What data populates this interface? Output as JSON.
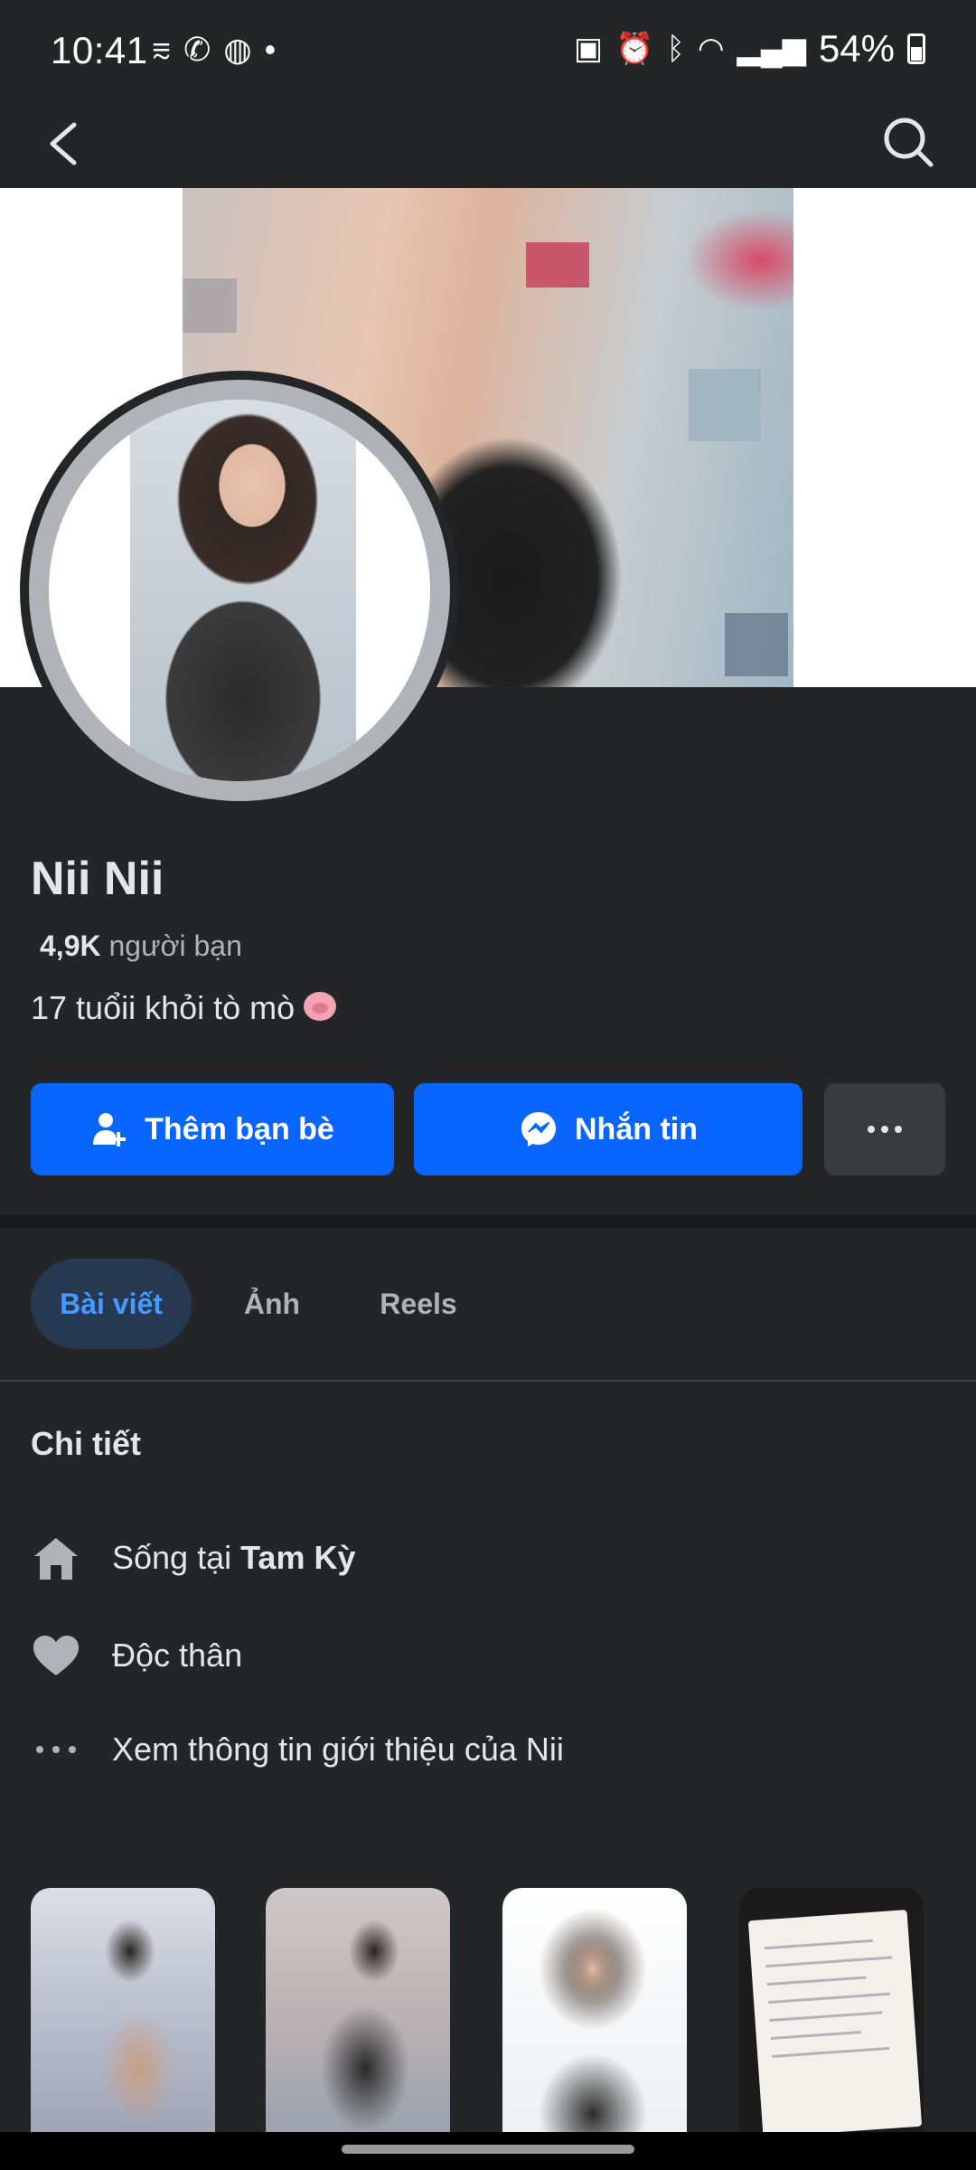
{
  "status_bar": {
    "time": "10:41",
    "battery": "54%"
  },
  "profile": {
    "name": "Nii Nii",
    "friends_count": "4,9K",
    "friends_label": "người bạn",
    "bio": "17 tuổii khỏi tò mò"
  },
  "actions": {
    "add_friend": "Thêm bạn bè",
    "message": "Nhắn tin"
  },
  "tabs": [
    {
      "label": "Bài viết",
      "active": true
    },
    {
      "label": "Ảnh",
      "active": false
    },
    {
      "label": "Reels",
      "active": false
    }
  ],
  "details": {
    "title": "Chi tiết",
    "lives_in_prefix": "Sống tại ",
    "lives_in_place": "Tam Kỳ",
    "relationship": "Độc thân",
    "see_about": "Xem thông tin giới thiệu của Nii"
  },
  "colors": {
    "background": "#242526",
    "primary_button": "#0866ff",
    "tab_active_bg": "#263951",
    "tab_active_text": "#4599ff"
  },
  "icons": [
    "back-icon",
    "search-icon",
    "add-friend-icon",
    "messenger-icon",
    "more-icon",
    "home-icon",
    "heart-icon",
    "more-dots-icon",
    "pig-emoji-icon"
  ]
}
